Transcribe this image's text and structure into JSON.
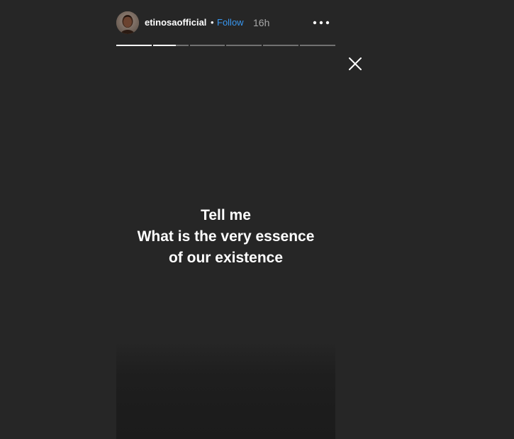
{
  "story": {
    "username": "etinosaofficial",
    "separator": "•",
    "follow_label": "Follow",
    "time_ago": "16h",
    "more_icon": "more-horizontal-icon",
    "close_icon": "close-icon",
    "progress": {
      "segment_count": 6,
      "current_index": 1,
      "current_fraction": 0.65
    },
    "caption": {
      "line1": "Tell me",
      "line2": "What is the very essence",
      "line3": "of our existence"
    }
  },
  "colors": {
    "background": "#262626",
    "follow": "#3897f0",
    "time": "#a8a8a8",
    "text": "#ffffff"
  }
}
